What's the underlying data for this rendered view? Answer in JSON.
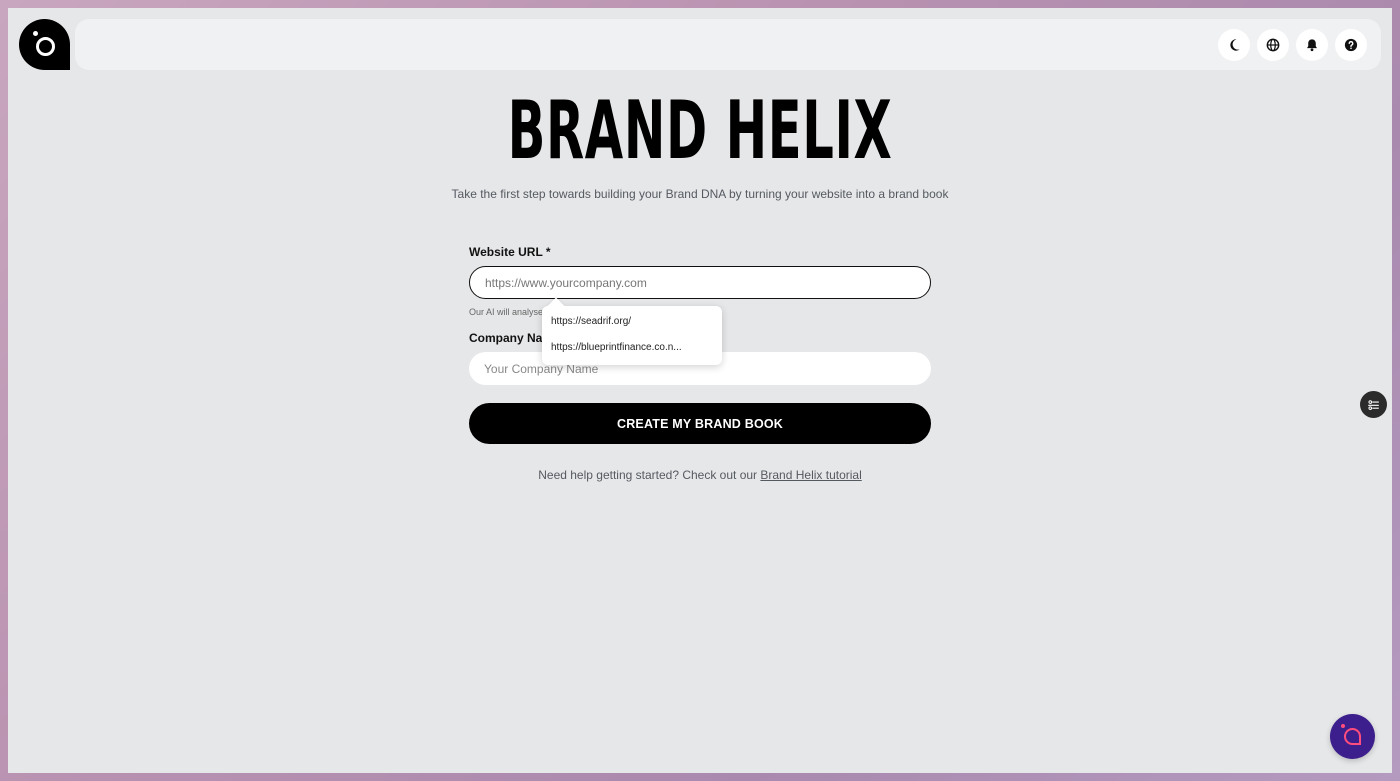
{
  "app": {
    "title": "BRAND HELIX",
    "subtitle": "Take the first step towards building your Brand DNA by turning your website into a brand book"
  },
  "topbar": {
    "icons": [
      "moon-icon",
      "globe-icon",
      "bell-icon",
      "help-icon"
    ]
  },
  "form": {
    "website_label": "Website URL *",
    "website_placeholder": "https://www.yourcompany.com",
    "website_value": "",
    "hint": "Our AI will analyse your website to create your brand book",
    "company_label": "Company Name *",
    "company_placeholder": "Your Company Name",
    "company_value": "",
    "submit_label": "CREATE MY BRAND BOOK"
  },
  "autocomplete": {
    "items": [
      "https://seadrif.org/",
      "https://blueprintfinance.co.n..."
    ]
  },
  "help": {
    "text": "Need help getting started? Check out our ",
    "link_label": "Brand Helix tutorial"
  },
  "colors": {
    "background": "#e6e7e9",
    "primary": "#000000",
    "assistant": "#3c1f8c",
    "assistant_accent": "#ff4d7d"
  }
}
